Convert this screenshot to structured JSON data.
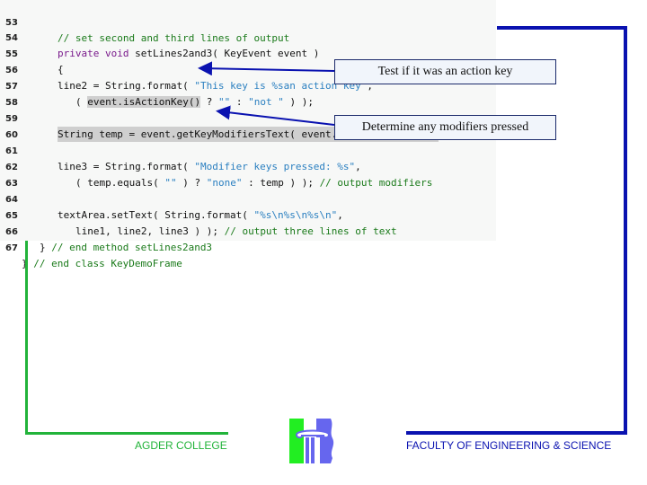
{
  "code": {
    "lines": [
      {
        "num": "53",
        "text": "// set second and third lines of output"
      },
      {
        "num": "54",
        "text": "private void setLines2and3( KeyEvent event )"
      },
      {
        "num": "55",
        "text": "{"
      },
      {
        "num": "56",
        "text": "line2 = String.format( \"This key is %san action key\","
      },
      {
        "num": "57",
        "text": "( event.isActionKey() ? \"\" : \"not \" ) );"
      },
      {
        "num": "58",
        "text": ""
      },
      {
        "num": "59",
        "text": "String temp = event.getKeyModifiersText( event.getModifiers() );"
      },
      {
        "num": "60",
        "text": ""
      },
      {
        "num": "61",
        "text": "line3 = String.format( \"Modifier keys pressed: %s\","
      },
      {
        "num": "62",
        "text": "( temp.equals( \"\" ) ? \"none\" : temp ) ); // output modifiers"
      },
      {
        "num": "63",
        "text": ""
      },
      {
        "num": "64",
        "text": "textArea.setText( String.format( \"%s\\n%s\\n%s\\n\","
      },
      {
        "num": "65",
        "text": "line1, line2, line3 ) ); // output three lines of text"
      },
      {
        "num": "66",
        "text": "} // end method setLines2and3"
      },
      {
        "num": "67",
        "text": "} // end class KeyDemoFrame"
      }
    ]
  },
  "callouts": {
    "action_key": "Test if it was an action key",
    "modifiers": "Determine any modifiers pressed"
  },
  "footer": {
    "left": "AGDER COLLEGE",
    "right": "FACULTY OF ENGINEERING & SCIENCE",
    "logo": "column-logo"
  },
  "colors": {
    "green": "#22b33a",
    "blue": "#0a12b0",
    "comment": "#1a7a1a",
    "string": "#2a7fc0",
    "keyword": "#7a1b8c"
  }
}
